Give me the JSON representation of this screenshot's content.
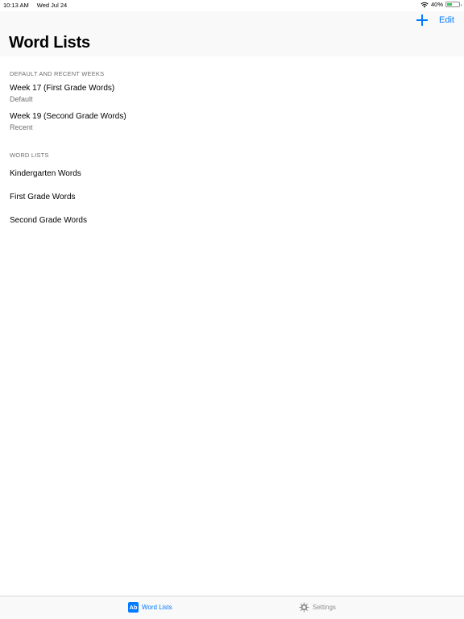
{
  "status_bar": {
    "time": "10:13 AM",
    "date": "Wed Jul 24",
    "battery_percent_label": "40%",
    "battery_level": 0.4,
    "battery_color": "#34c759"
  },
  "nav": {
    "title": "Word Lists",
    "add_icon": "plus-icon",
    "edit_label": "Edit",
    "accent_color": "#007aff"
  },
  "sections": [
    {
      "header": "DEFAULT AND RECENT WEEKS",
      "items": [
        {
          "title": "Week 17 (First Grade Words)",
          "subtitle": "Default"
        },
        {
          "title": "Week 19 (Second Grade Words)",
          "subtitle": "Recent"
        }
      ]
    },
    {
      "header": "WORD LISTS",
      "items": [
        {
          "title": "Kindergarten Words"
        },
        {
          "title": "First Grade Words"
        },
        {
          "title": "Second Grade Words"
        }
      ]
    }
  ],
  "tab_bar": {
    "tabs": [
      {
        "label": "Word Lists",
        "icon": "ab-icon",
        "icon_text": "Ab",
        "selected": true
      },
      {
        "label": "Settings",
        "icon": "gear-icon",
        "selected": false
      }
    ]
  }
}
